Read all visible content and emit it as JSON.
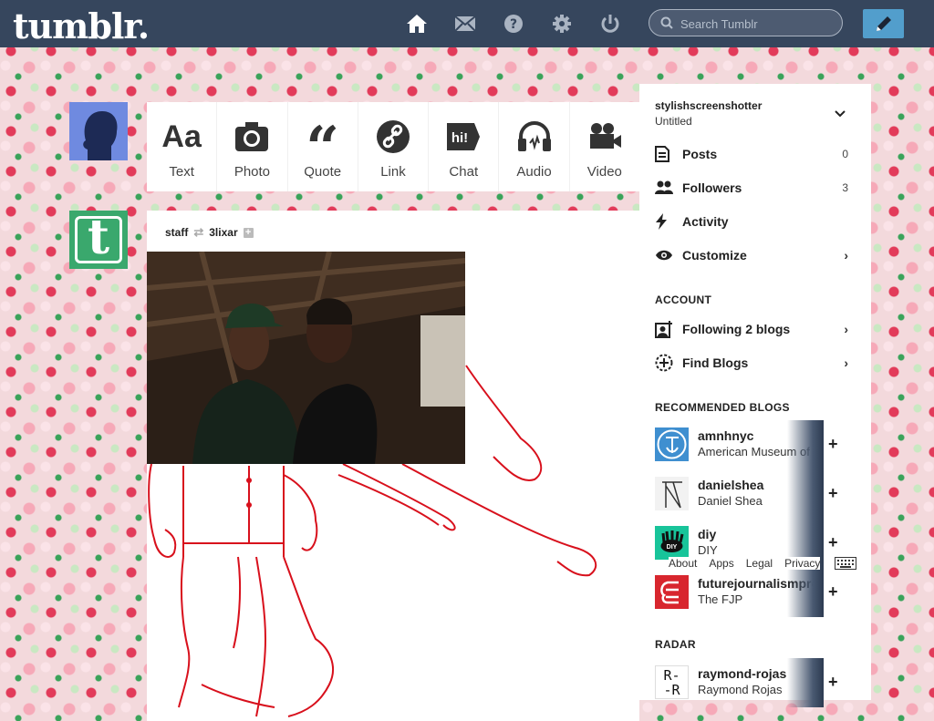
{
  "topbar": {
    "logo": "tumblr.",
    "search_placeholder": "Search Tumblr",
    "nav": [
      "home-icon",
      "mail-icon",
      "help-icon",
      "gear-icon",
      "power-icon"
    ]
  },
  "post_types": [
    {
      "label": "Text",
      "icon": "text-icon"
    },
    {
      "label": "Photo",
      "icon": "camera-icon"
    },
    {
      "label": "Quote",
      "icon": "quote-icon"
    },
    {
      "label": "Link",
      "icon": "link-icon"
    },
    {
      "label": "Chat",
      "icon": "chat-icon"
    },
    {
      "label": "Audio",
      "icon": "headphones-icon"
    },
    {
      "label": "Video",
      "icon": "video-camera-icon"
    }
  ],
  "post": {
    "author": "staff",
    "reblogged_from": "3lixar"
  },
  "sidebar": {
    "username": "stylishscreenshotter",
    "blog_title": "Untitled",
    "items": [
      {
        "label": "Posts",
        "count": "0"
      },
      {
        "label": "Followers",
        "count": "3"
      },
      {
        "label": "Activity",
        "count": ""
      },
      {
        "label": "Customize",
        "count": ""
      }
    ],
    "account_heading": "ACCOUNT",
    "account_items": [
      {
        "label": "Following 2 blogs"
      },
      {
        "label": "Find Blogs"
      }
    ],
    "recommended_heading": "RECOMMENDED BLOGS",
    "recommended": [
      {
        "name": "amnhnyc",
        "desc": "American Museum of N"
      },
      {
        "name": "danielshea",
        "desc": "Daniel Shea"
      },
      {
        "name": "diy",
        "desc": "DIY"
      },
      {
        "name": "futurejournalismpro",
        "desc": "The FJP"
      }
    ],
    "footer_links": [
      "About",
      "Apps",
      "Legal",
      "Privacy"
    ],
    "radar_heading": "RADAR",
    "radar": {
      "name": "raymond-rojas",
      "desc": "Raymond Rojas",
      "avatar_text": "R-\n-R"
    }
  },
  "colors": {
    "topbar": "#36465d",
    "accent": "#529ecc",
    "staff_green": "#3aa86d"
  }
}
